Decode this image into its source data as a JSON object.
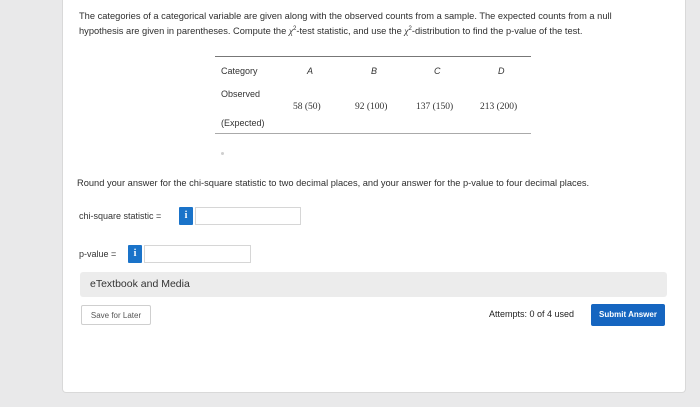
{
  "question": {
    "line1": "The categories of a categorical variable are given along with the observed counts from a sample. The expected counts from a null",
    "line2a": "hypothesis are given in parentheses. Compute the ",
    "chi": "χ",
    "sup": "2",
    "line2b": "-test statistic, and use the ",
    "line2c": "-distribution to find the p-value of the test."
  },
  "table": {
    "header_label": "Category",
    "categories": [
      "A",
      "B",
      "C",
      "D"
    ],
    "observed_label": "Observed",
    "expected_label": "(Expected)",
    "values": [
      "58 (50)",
      "92 (100)",
      "137 (150)",
      "213 (200)"
    ]
  },
  "instructions": "Round your answer for the chi-square statistic to two decimal places, and your answer for the p-value to four decimal places.",
  "answers": {
    "chi_label": "chi-square statistic =",
    "pvalue_label": "p-value =",
    "info_glyph": "i",
    "chi_value": "",
    "pvalue_value": ""
  },
  "etextbook": {
    "label": "eTextbook and Media"
  },
  "footer": {
    "save_label": "Save for Later",
    "attempts": "Attempts: 0 of 4 used",
    "submit_label": "Submit Answer"
  },
  "colors": {
    "accent": "#1565c0",
    "info": "#1a73c9",
    "background": "#e9e9ea"
  }
}
